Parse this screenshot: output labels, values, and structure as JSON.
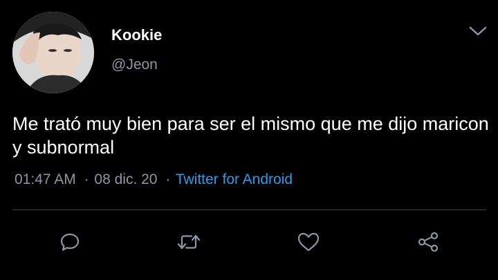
{
  "author": {
    "display_name": "Kookie",
    "handle": "@Jeon"
  },
  "tweet": {
    "text": "Me trató muy bien para ser el mismo que me dijo maricon y subnormal",
    "time": "01:47 AM",
    "date": "08 dic. 20",
    "separator": "·",
    "source": "Twitter for Android"
  },
  "icons": {
    "menu": "chevron-down-icon",
    "reply": "reply-icon",
    "retweet": "retweet-icon",
    "like": "heart-icon",
    "share": "share-icon"
  },
  "colors": {
    "background": "#000000",
    "text": "#ffffff",
    "muted": "#8899a6",
    "link": "#1da1f2",
    "divider": "#3d4247"
  }
}
